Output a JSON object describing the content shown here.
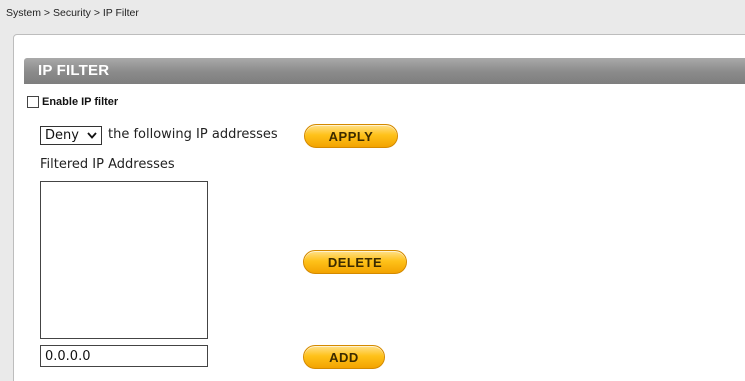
{
  "breadcrumb": "System > Security > IP Filter",
  "section": {
    "title": "IP FILTER"
  },
  "enable": {
    "label": "Enable IP filter",
    "checked": false
  },
  "mode": {
    "selected": "Deny",
    "suffix_text": "the following IP addresses"
  },
  "buttons": {
    "apply": "APPLY",
    "delete": "DELETE",
    "add": "ADD"
  },
  "filtered_list": {
    "label": "Filtered IP Addresses",
    "items": []
  },
  "ip_input": {
    "value": "0.0.0.0"
  },
  "colors": {
    "button_fill": "#ffc21a",
    "header_bar": "#8a8a8a",
    "background": "#eaeaea"
  },
  "icons": {
    "select_arrow": "chevron-down-icon"
  }
}
